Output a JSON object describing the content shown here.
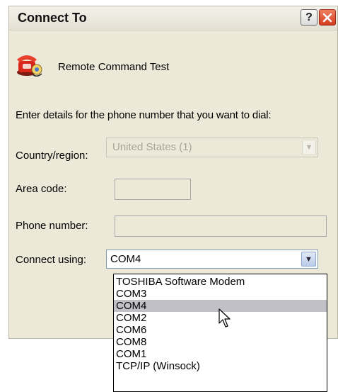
{
  "dialog": {
    "title": "Connect To",
    "help_label": "?",
    "connection_name": "Remote Command Test",
    "instructions": "Enter details for the phone number that you want to dial:"
  },
  "form": {
    "country_label": "Country/region:",
    "country_value": "United States (1)",
    "area_code_label": "Area code:",
    "area_code_value": "",
    "phone_label": "Phone number:",
    "phone_value": "",
    "connect_using_label": "Connect using:",
    "connect_using_value": "COM4"
  },
  "dropdown": {
    "options": [
      "TOSHIBA Software Modem",
      "COM3",
      "COM4",
      "COM2",
      "COM6",
      "COM8",
      "COM1",
      "TCP/IP (Winsock)"
    ],
    "selected": "COM4"
  },
  "icons": {
    "phone": "phone-icon",
    "close": "close-icon",
    "help": "help-icon",
    "cursor": "mouse-cursor-icon"
  }
}
